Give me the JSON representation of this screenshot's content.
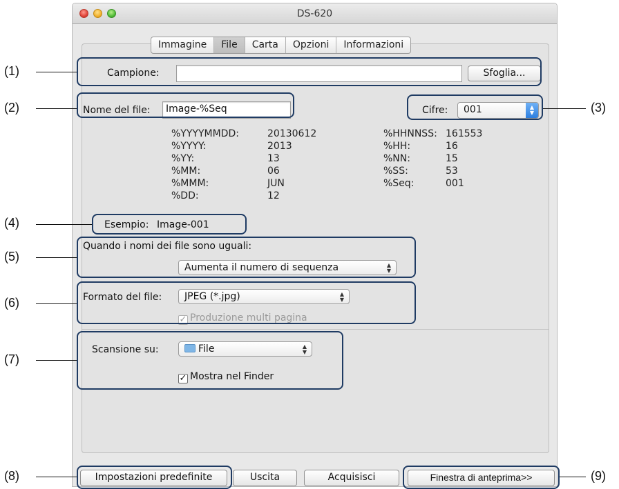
{
  "window": {
    "title": "DS-620"
  },
  "tabs": [
    "Immagine",
    "File",
    "Carta",
    "Opzioni",
    "Informazioni"
  ],
  "template": {
    "label": "Campione:",
    "value": "",
    "browse_label": "Sfoglia..."
  },
  "filename": {
    "label": "Nome del file:",
    "value": "Image-%Seq"
  },
  "digits": {
    "label": "Cifre:",
    "value": "001"
  },
  "variables": [
    {
      "key": "%YYYYMMDD:",
      "value": "20130612"
    },
    {
      "key": "%YYYY:",
      "value": "2013"
    },
    {
      "key": "%YY:",
      "value": "13"
    },
    {
      "key": "%MM:",
      "value": "06"
    },
    {
      "key": "%MMM:",
      "value": "JUN"
    },
    {
      "key": "%DD:",
      "value": "12"
    },
    {
      "key": "%HHNNSS:",
      "value": "161553"
    },
    {
      "key": "%HH:",
      "value": "16"
    },
    {
      "key": "%NN:",
      "value": "15"
    },
    {
      "key": "%SS:",
      "value": "53"
    },
    {
      "key": "%Seq:",
      "value": "001"
    }
  ],
  "example": {
    "label": "Esempio:",
    "value": "Image-001"
  },
  "same_name": {
    "label": "Quando i nomi dei file sono uguali:",
    "value": "Aumenta il numero di sequenza"
  },
  "format": {
    "label": "Formato del file:",
    "value": "JPEG (*.jpg)",
    "multipage_label": "Produzione multi pagina"
  },
  "scan_to": {
    "label": "Scansione su:",
    "value": "File",
    "show_finder_label": "Mostra nel Finder"
  },
  "buttons": {
    "defaults": "Impostazioni predefinite",
    "exit": "Uscita",
    "acquire": "Acquisisci",
    "preview": "Finestra di anteprima>>"
  },
  "callouts": [
    "(1)",
    "(2)",
    "(3)",
    "(4)",
    "(5)",
    "(6)",
    "(7)",
    "(8)",
    "(9)"
  ],
  "colors": {
    "annotation_border": "#1f3b63",
    "window_bg": "#e8e8e8",
    "selected_tab": "#c6c6c6",
    "stepper_blue": "#2d7fe0"
  }
}
